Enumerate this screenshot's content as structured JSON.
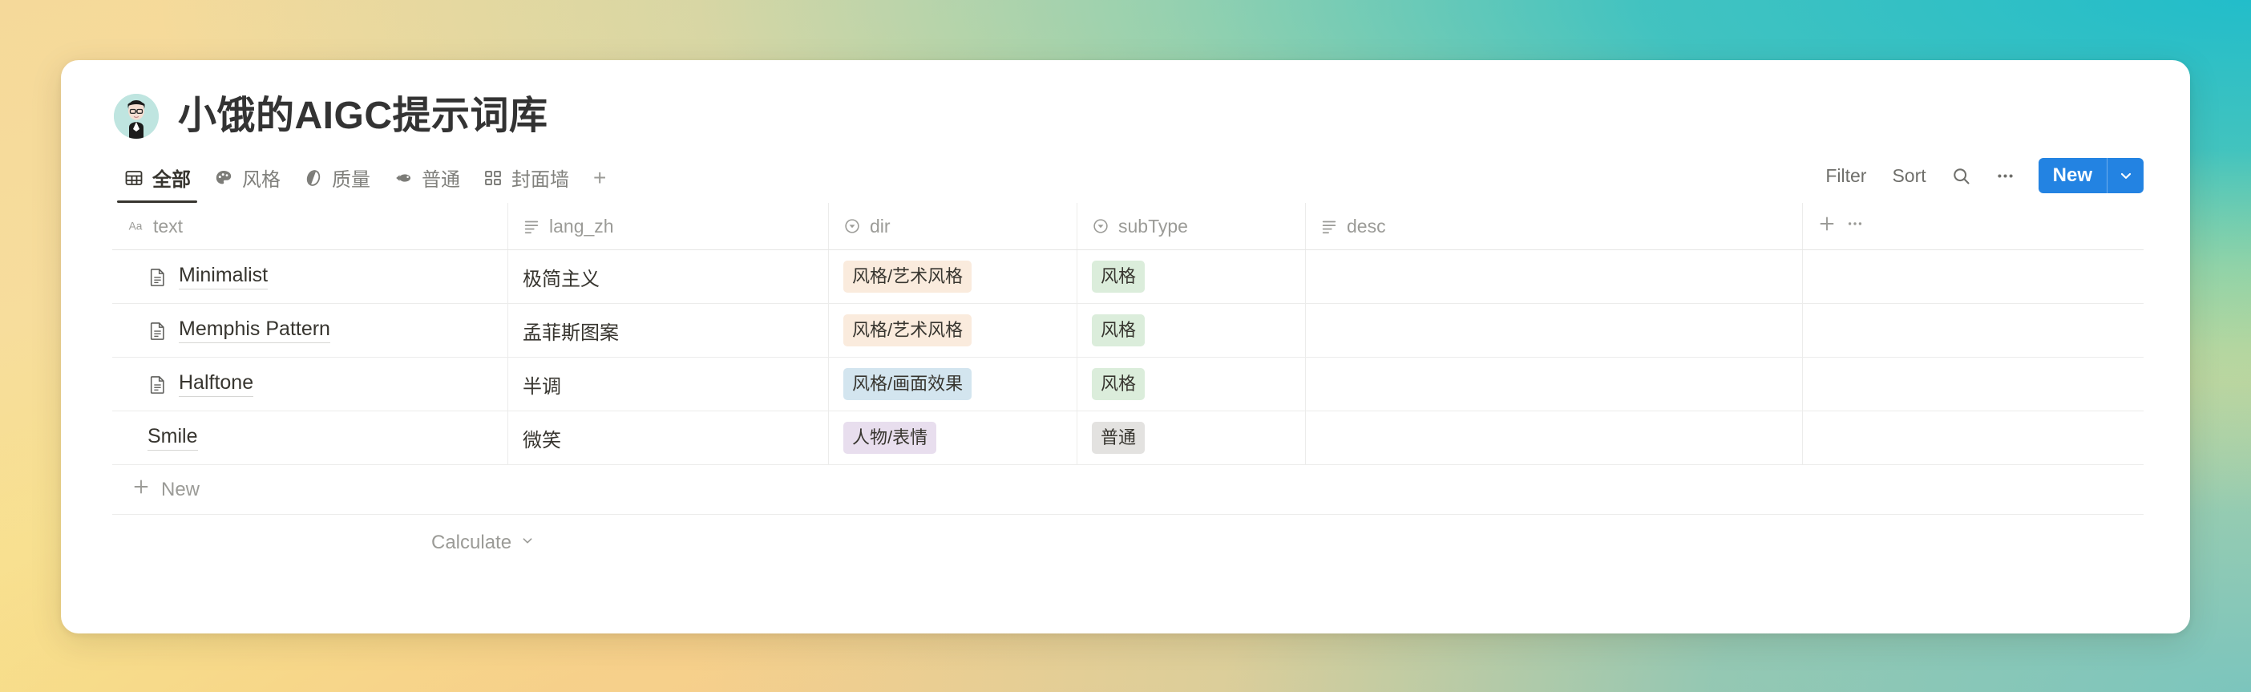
{
  "window": {
    "background_top_left": "#f5d99a",
    "background_top_right": "#22bdca",
    "background_bottom_left": "#f7e979",
    "background_bottom_right": "#7cc5bd"
  },
  "header": {
    "title": "小饿的AIGC提示词库",
    "avatar_icon": "person-avatar-icon"
  },
  "tabs": [
    {
      "label": "全部",
      "icon": "table-icon",
      "active": true,
      "name": "tab-all"
    },
    {
      "label": "风格",
      "icon": "palette-icon",
      "active": false,
      "name": "tab-style"
    },
    {
      "label": "质量",
      "icon": "contrast-icon",
      "active": false,
      "name": "tab-quality"
    },
    {
      "label": "普通",
      "icon": "fish-icon",
      "active": false,
      "name": "tab-normal"
    },
    {
      "label": "封面墙",
      "icon": "gallery-icon",
      "active": false,
      "name": "tab-cover-wall"
    }
  ],
  "tab_add_label": "+",
  "toolbar": {
    "filter_label": "Filter",
    "sort_label": "Sort",
    "search_icon": "search-icon",
    "more_icon": "ellipsis-icon",
    "new_label": "New",
    "new_caret_icon": "chevron-down-icon",
    "new_button_color": "#2383e2"
  },
  "table": {
    "columns": [
      {
        "label": "text",
        "icon": "title-aa-icon",
        "type": "title"
      },
      {
        "label": "lang_zh",
        "icon": "text-lines-icon",
        "type": "text"
      },
      {
        "label": "dir",
        "icon": "select-icon",
        "type": "select"
      },
      {
        "label": "subType",
        "icon": "select-icon",
        "type": "select"
      },
      {
        "label": "desc",
        "icon": "text-lines-icon",
        "type": "text"
      }
    ],
    "add_column_icon": "plus-icon",
    "column_menu_icon": "ellipsis-icon",
    "rows": [
      {
        "text": "Minimalist",
        "has_page_icon": true,
        "lang_zh": "极简主义",
        "dir": "风格/艺术风格",
        "dir_color": "orange",
        "subType": "风格",
        "subType_color": "green",
        "desc": ""
      },
      {
        "text": "Memphis Pattern",
        "has_page_icon": true,
        "lang_zh": "孟菲斯图案",
        "dir": "风格/艺术风格",
        "dir_color": "orange",
        "subType": "风格",
        "subType_color": "green",
        "desc": ""
      },
      {
        "text": "Halftone",
        "has_page_icon": true,
        "lang_zh": "半调",
        "dir": "风格/画面效果",
        "dir_color": "blue",
        "subType": "风格",
        "subType_color": "green",
        "desc": ""
      },
      {
        "text": "Smile",
        "has_page_icon": false,
        "lang_zh": "微笑",
        "dir": "人物/表情",
        "dir_color": "purple",
        "subType": "普通",
        "subType_color": "gray",
        "desc": ""
      }
    ],
    "new_row_label": "New",
    "new_row_icon": "plus-icon",
    "calculate_label": "Calculate",
    "calculate_icon": "chevron-down-icon"
  }
}
